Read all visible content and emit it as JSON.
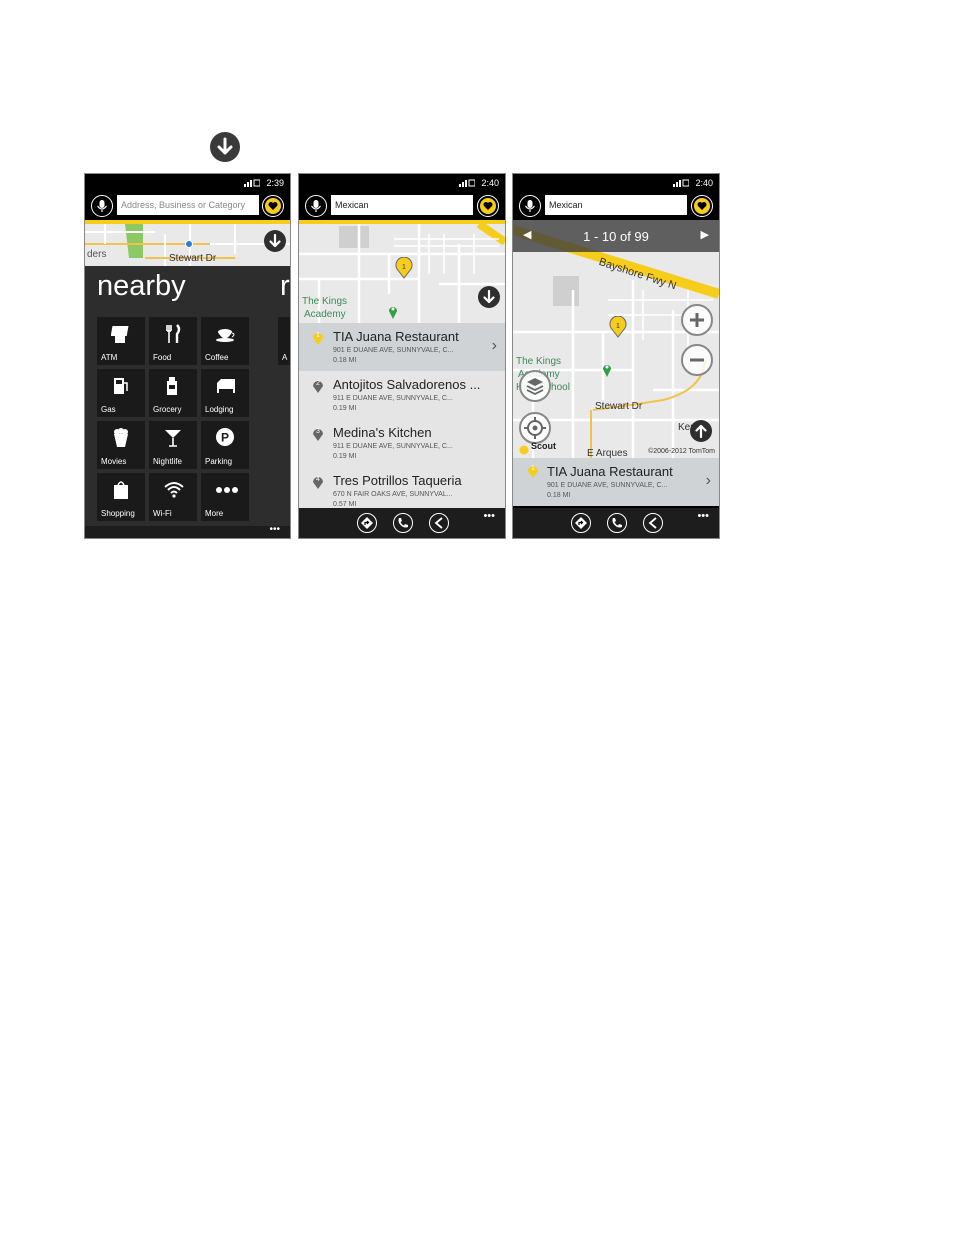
{
  "phones": [
    {
      "time": "2:39",
      "search_placeholder": "Address, Business or Category",
      "map_labels": [
        "ders",
        "Stewart Dr"
      ],
      "heading": "nearby",
      "heading_peek": "r",
      "tile_peek": "A",
      "categories": [
        "ATM",
        "Food",
        "Coffee",
        "Gas",
        "Grocery",
        "Lodging",
        "Movies",
        "Nightlife",
        "Parking",
        "Shopping",
        "Wi-Fi",
        "More"
      ],
      "more_dots": "•••"
    },
    {
      "time": "2:40",
      "search_value": "Mexican",
      "map_labels": [
        "The Kings",
        "Academy"
      ],
      "results": [
        {
          "num": "1",
          "name": "TIA Juana Restaurant",
          "addr": "901 E DUANE AVE, SUNNYVALE, C...",
          "dist": "0.18 MI"
        },
        {
          "num": "2",
          "name": "Antojitos Salvadorenos ...",
          "addr": "911 E DUANE AVE, SUNNYVALE, C...",
          "dist": "0.19 MI"
        },
        {
          "num": "3",
          "name": "Medina's Kitchen",
          "addr": "911 E DUANE AVE, SUNNYVALE, C...",
          "dist": "0.19 MI"
        },
        {
          "num": "4",
          "name": "Tres Potrillos Taqueria",
          "addr": "670 N FAIR OAKS AVE, SUNNYVAL...",
          "dist": "0.57 MI"
        }
      ],
      "more_dots": "•••"
    },
    {
      "time": "2:40",
      "search_value": "Mexican",
      "pager": "1 - 10 of 99",
      "map_labels": [
        "Bayshore Fwy N",
        "The Kings",
        "Academy",
        "High School",
        "Stewart Dr",
        "E Arques",
        "Ker"
      ],
      "copyright": "©2006-2012 TomTom",
      "brand": "Scout",
      "result": {
        "num": "1",
        "name": "TIA Juana Restaurant",
        "addr": "901 E DUANE AVE, SUNNYVALE, C...",
        "dist": "0.18 MI"
      },
      "more_dots": "•••"
    }
  ],
  "colors": {
    "accent": "#f7cd1b",
    "tile": "#1a1a1a",
    "panel": "#2d2d2d"
  }
}
